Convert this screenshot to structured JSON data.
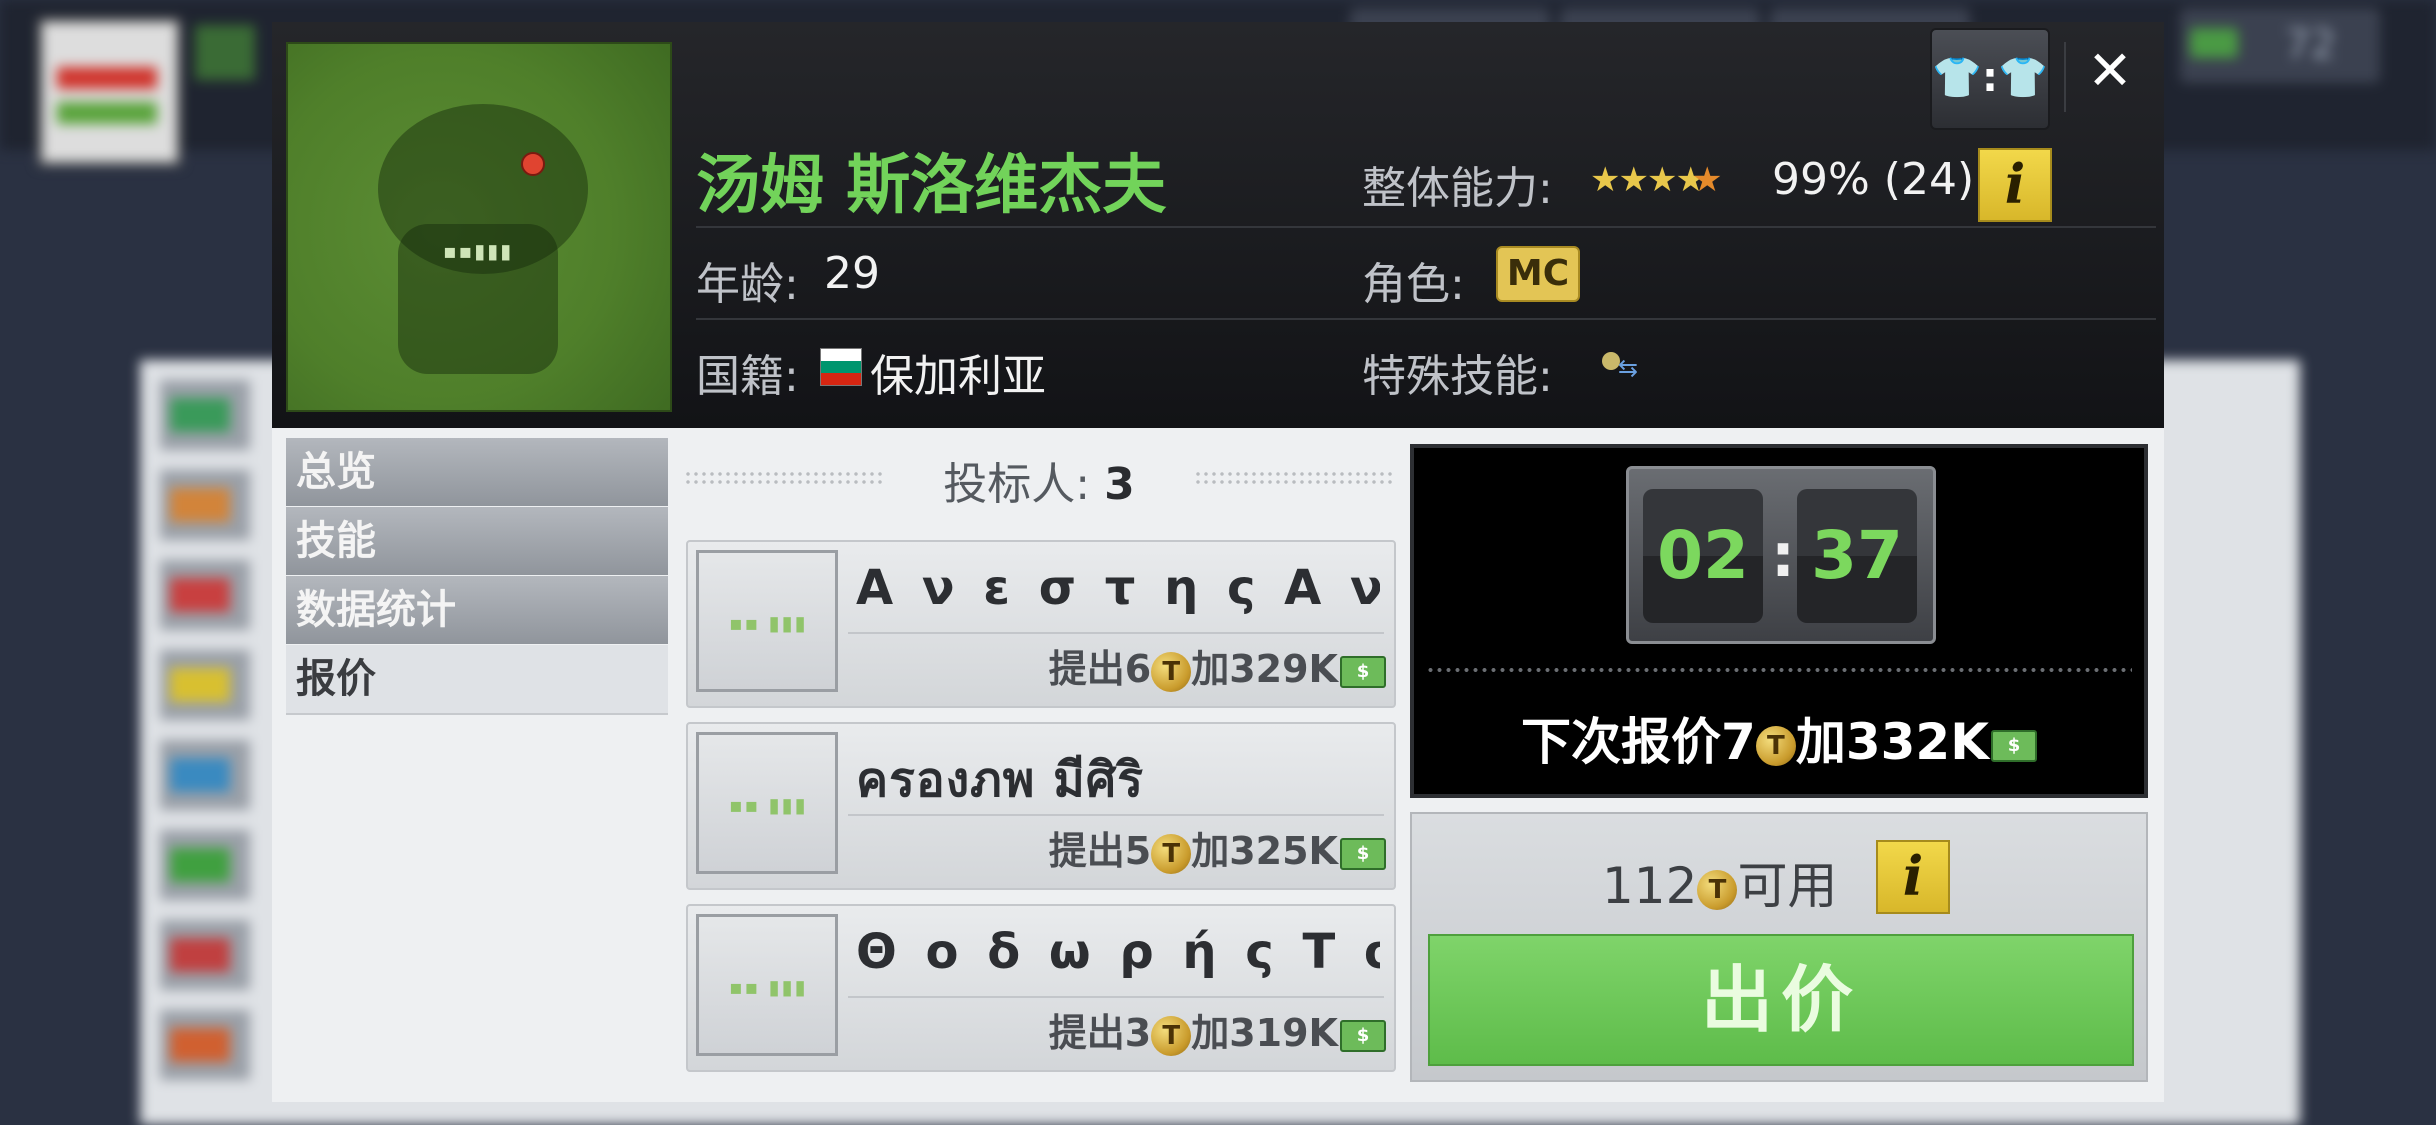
{
  "background": {
    "money_value": "72"
  },
  "player": {
    "name": "汤姆 斯洛维杰夫",
    "age_label": "年龄:",
    "age": "29",
    "nationality_label": "国籍:",
    "nationality": "保加利亚",
    "overall_label": "整体能力:",
    "overall_value": "99% (24)",
    "stars": 4.5,
    "role_label": "角色:",
    "role": "MC",
    "special_skill_label": "特殊技能:"
  },
  "header_buttons": {
    "kit_label": "👕:👕",
    "close_label": "✕",
    "info_label": "i"
  },
  "tabs": [
    {
      "label": "总览",
      "active": false
    },
    {
      "label": "技能",
      "active": false
    },
    {
      "label": "数据统计",
      "active": false
    },
    {
      "label": "报价",
      "active": true
    }
  ],
  "bidders": {
    "title": "投标人:",
    "count": "3",
    "list": [
      {
        "name": "Α ν ε σ τ η ς Α ν...",
        "offer_prefix": "提出6",
        "offer_suffix": "加329K"
      },
      {
        "name": "ครองภพ มีศิริ",
        "offer_prefix": "提出5",
        "offer_suffix": "加325K"
      },
      {
        "name": "Θ ο δ ω ρ ή ς Τ σ...",
        "offer_prefix": "提出3",
        "offer_suffix": "加319K"
      }
    ]
  },
  "timer": {
    "minutes": "02",
    "seconds": "37",
    "separator": ":",
    "next_bid_prefix": "下次报价7",
    "next_bid_suffix": "加332K"
  },
  "bid_panel": {
    "available_amount": "112",
    "available_label": "可用",
    "bid_button_label": "出价"
  },
  "icons": {
    "coin_glyph": "T",
    "cash_glyph": "$"
  },
  "colors": {
    "name_green": "#72d35a",
    "bid_button": "#6cc85a",
    "timer_digits": "#7cd85e",
    "info_yellow": "#e8cc3a"
  }
}
